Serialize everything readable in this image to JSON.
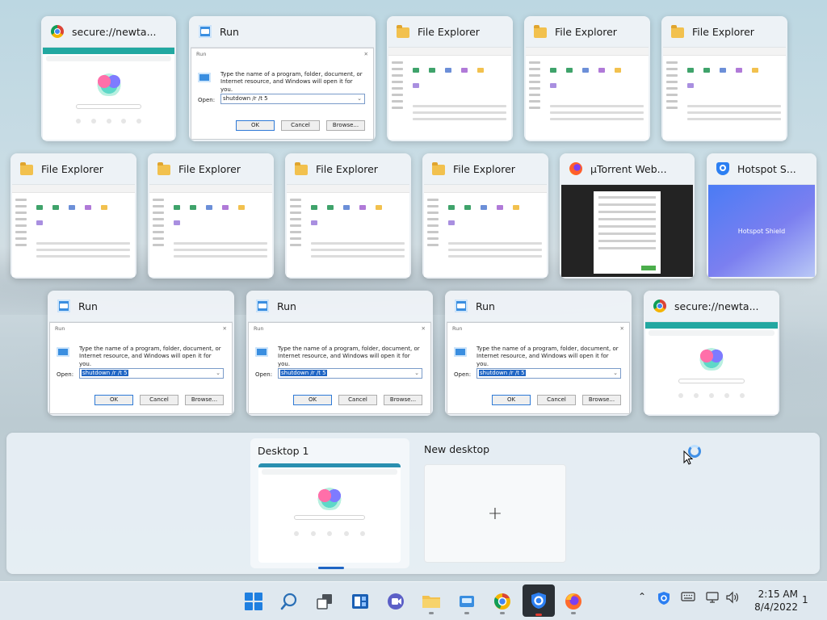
{
  "windows": [
    {
      "title": "secure://newta...",
      "icon": "chrome-icon",
      "kind": "browser"
    },
    {
      "title": "Run",
      "icon": "run-icon",
      "kind": "run"
    },
    {
      "title": "File Explorer",
      "icon": "folder-icon",
      "kind": "explorer"
    },
    {
      "title": "File Explorer",
      "icon": "folder-icon",
      "kind": "explorer"
    },
    {
      "title": "File Explorer",
      "icon": "folder-icon",
      "kind": "explorer"
    },
    {
      "title": "File Explorer",
      "icon": "folder-icon",
      "kind": "explorer"
    },
    {
      "title": "File Explorer",
      "icon": "folder-icon",
      "kind": "explorer"
    },
    {
      "title": "File Explorer",
      "icon": "folder-icon",
      "kind": "explorer"
    },
    {
      "title": "File Explorer",
      "icon": "folder-icon",
      "kind": "explorer"
    },
    {
      "title": "µTorrent Web...",
      "icon": "firefox-icon",
      "kind": "utorrent"
    },
    {
      "title": "Hotspot S...",
      "icon": "shield-icon",
      "kind": "hotspot"
    },
    {
      "title": "Run",
      "icon": "run-icon",
      "kind": "run"
    },
    {
      "title": "Run",
      "icon": "run-icon",
      "kind": "run"
    },
    {
      "title": "Run",
      "icon": "run-icon",
      "kind": "run"
    },
    {
      "title": "secure://newta...",
      "icon": "chrome-icon",
      "kind": "browser"
    }
  ],
  "run_dialog": {
    "title": "Run",
    "description": "Type the name of a program, folder, document, or Internet resource, and Windows will open it for you.",
    "open_label": "Open:",
    "command": "shutdown /r /t 5",
    "ok": "OK",
    "cancel": "Cancel",
    "browse": "Browse..."
  },
  "hotspot_label": "Hotspot Shield",
  "desktops": {
    "current": "Desktop 1",
    "new": "New desktop",
    "add_symbol": "+"
  },
  "taskbar": {
    "items": [
      "start-icon",
      "search-icon",
      "task-view-icon",
      "widgets-icon",
      "chat-icon",
      "file-explorer-icon",
      "run-icon",
      "chrome-icon",
      "hotspot-shield-icon",
      "firefox-icon"
    ],
    "time": "2:15 AM",
    "date": "8/4/2022",
    "notification_count": "1",
    "tray": [
      "chevron-up-icon",
      "shield-tray-icon",
      "keyboard-icon",
      "network-icon",
      "volume-icon"
    ]
  }
}
